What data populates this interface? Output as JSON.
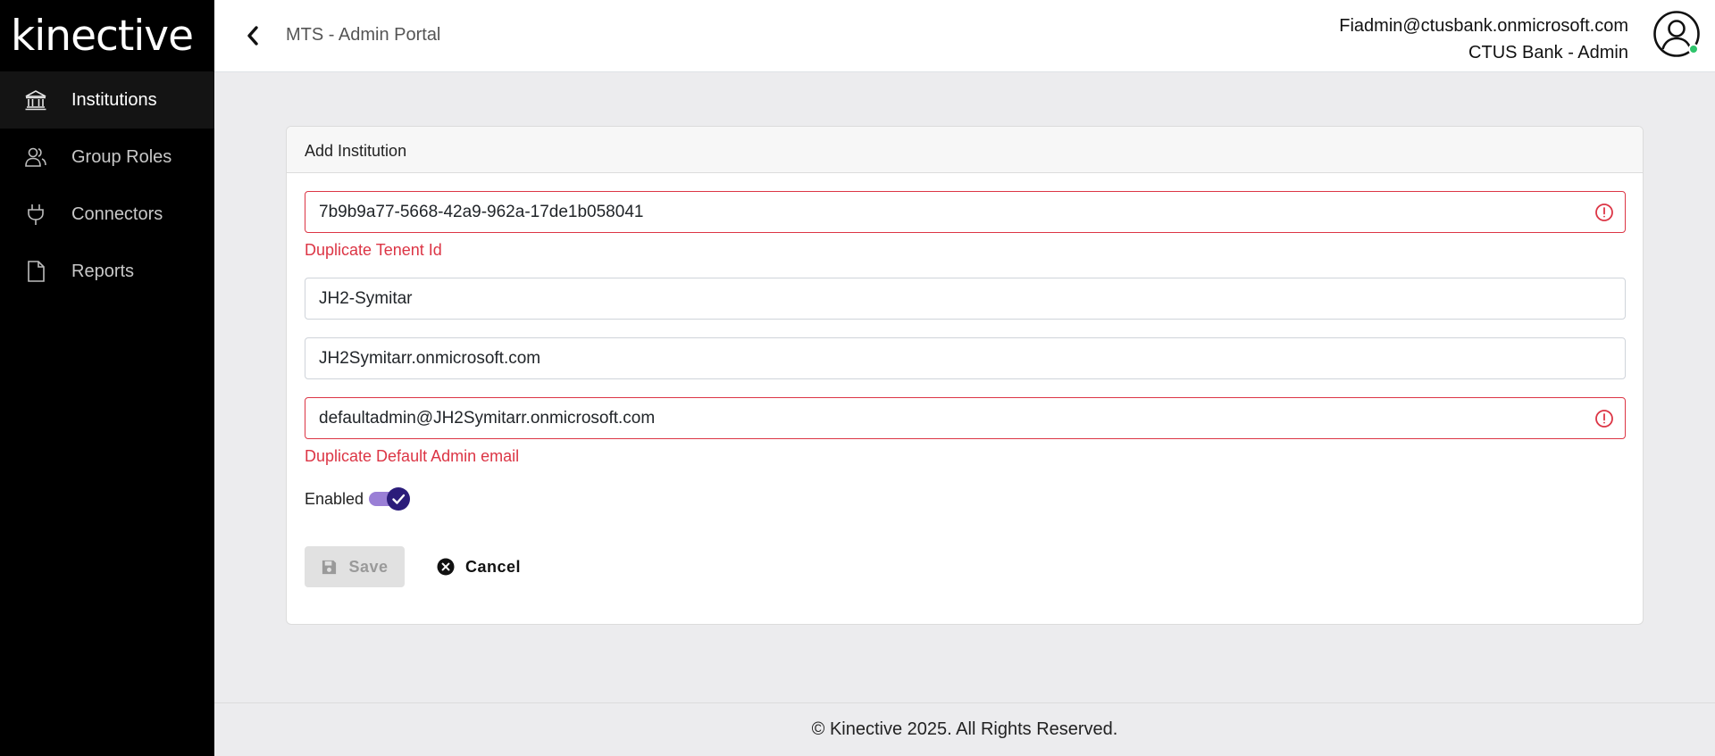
{
  "brand": {
    "name": "kinective",
    "accent": "#b5d334"
  },
  "sidebar": {
    "items": [
      {
        "label": "Institutions",
        "icon": "bank-icon",
        "active": true
      },
      {
        "label": "Group Roles",
        "icon": "users-icon",
        "active": false
      },
      {
        "label": "Connectors",
        "icon": "plug-icon",
        "active": false
      },
      {
        "label": "Reports",
        "icon": "document-icon",
        "active": false
      }
    ]
  },
  "header": {
    "title": "MTS - Admin Portal",
    "user_email": "Fiadmin@ctusbank.onmicrosoft.com",
    "user_role": "CTUS Bank - Admin",
    "status_color": "#2ec46b"
  },
  "card": {
    "title": "Add Institution",
    "tenant_id": {
      "value": "7b9b9a77-5668-42a9-962a-17de1b058041",
      "error": "Duplicate Tenent Id"
    },
    "name": {
      "value": "JH2-Symitar"
    },
    "domain": {
      "value": "JH2Symitarr.onmicrosoft.com"
    },
    "admin_email": {
      "value": "defaultadmin@JH2Symitarr.onmicrosoft.com",
      "error": "Duplicate Default Admin email"
    },
    "enabled_label": "Enabled",
    "enabled": true,
    "save_label": "Save",
    "cancel_label": "Cancel",
    "error_color": "#dc3545",
    "toggle_color": "#2b1c7a"
  },
  "footer": {
    "text": "© Kinective 2025. All Rights Reserved."
  }
}
